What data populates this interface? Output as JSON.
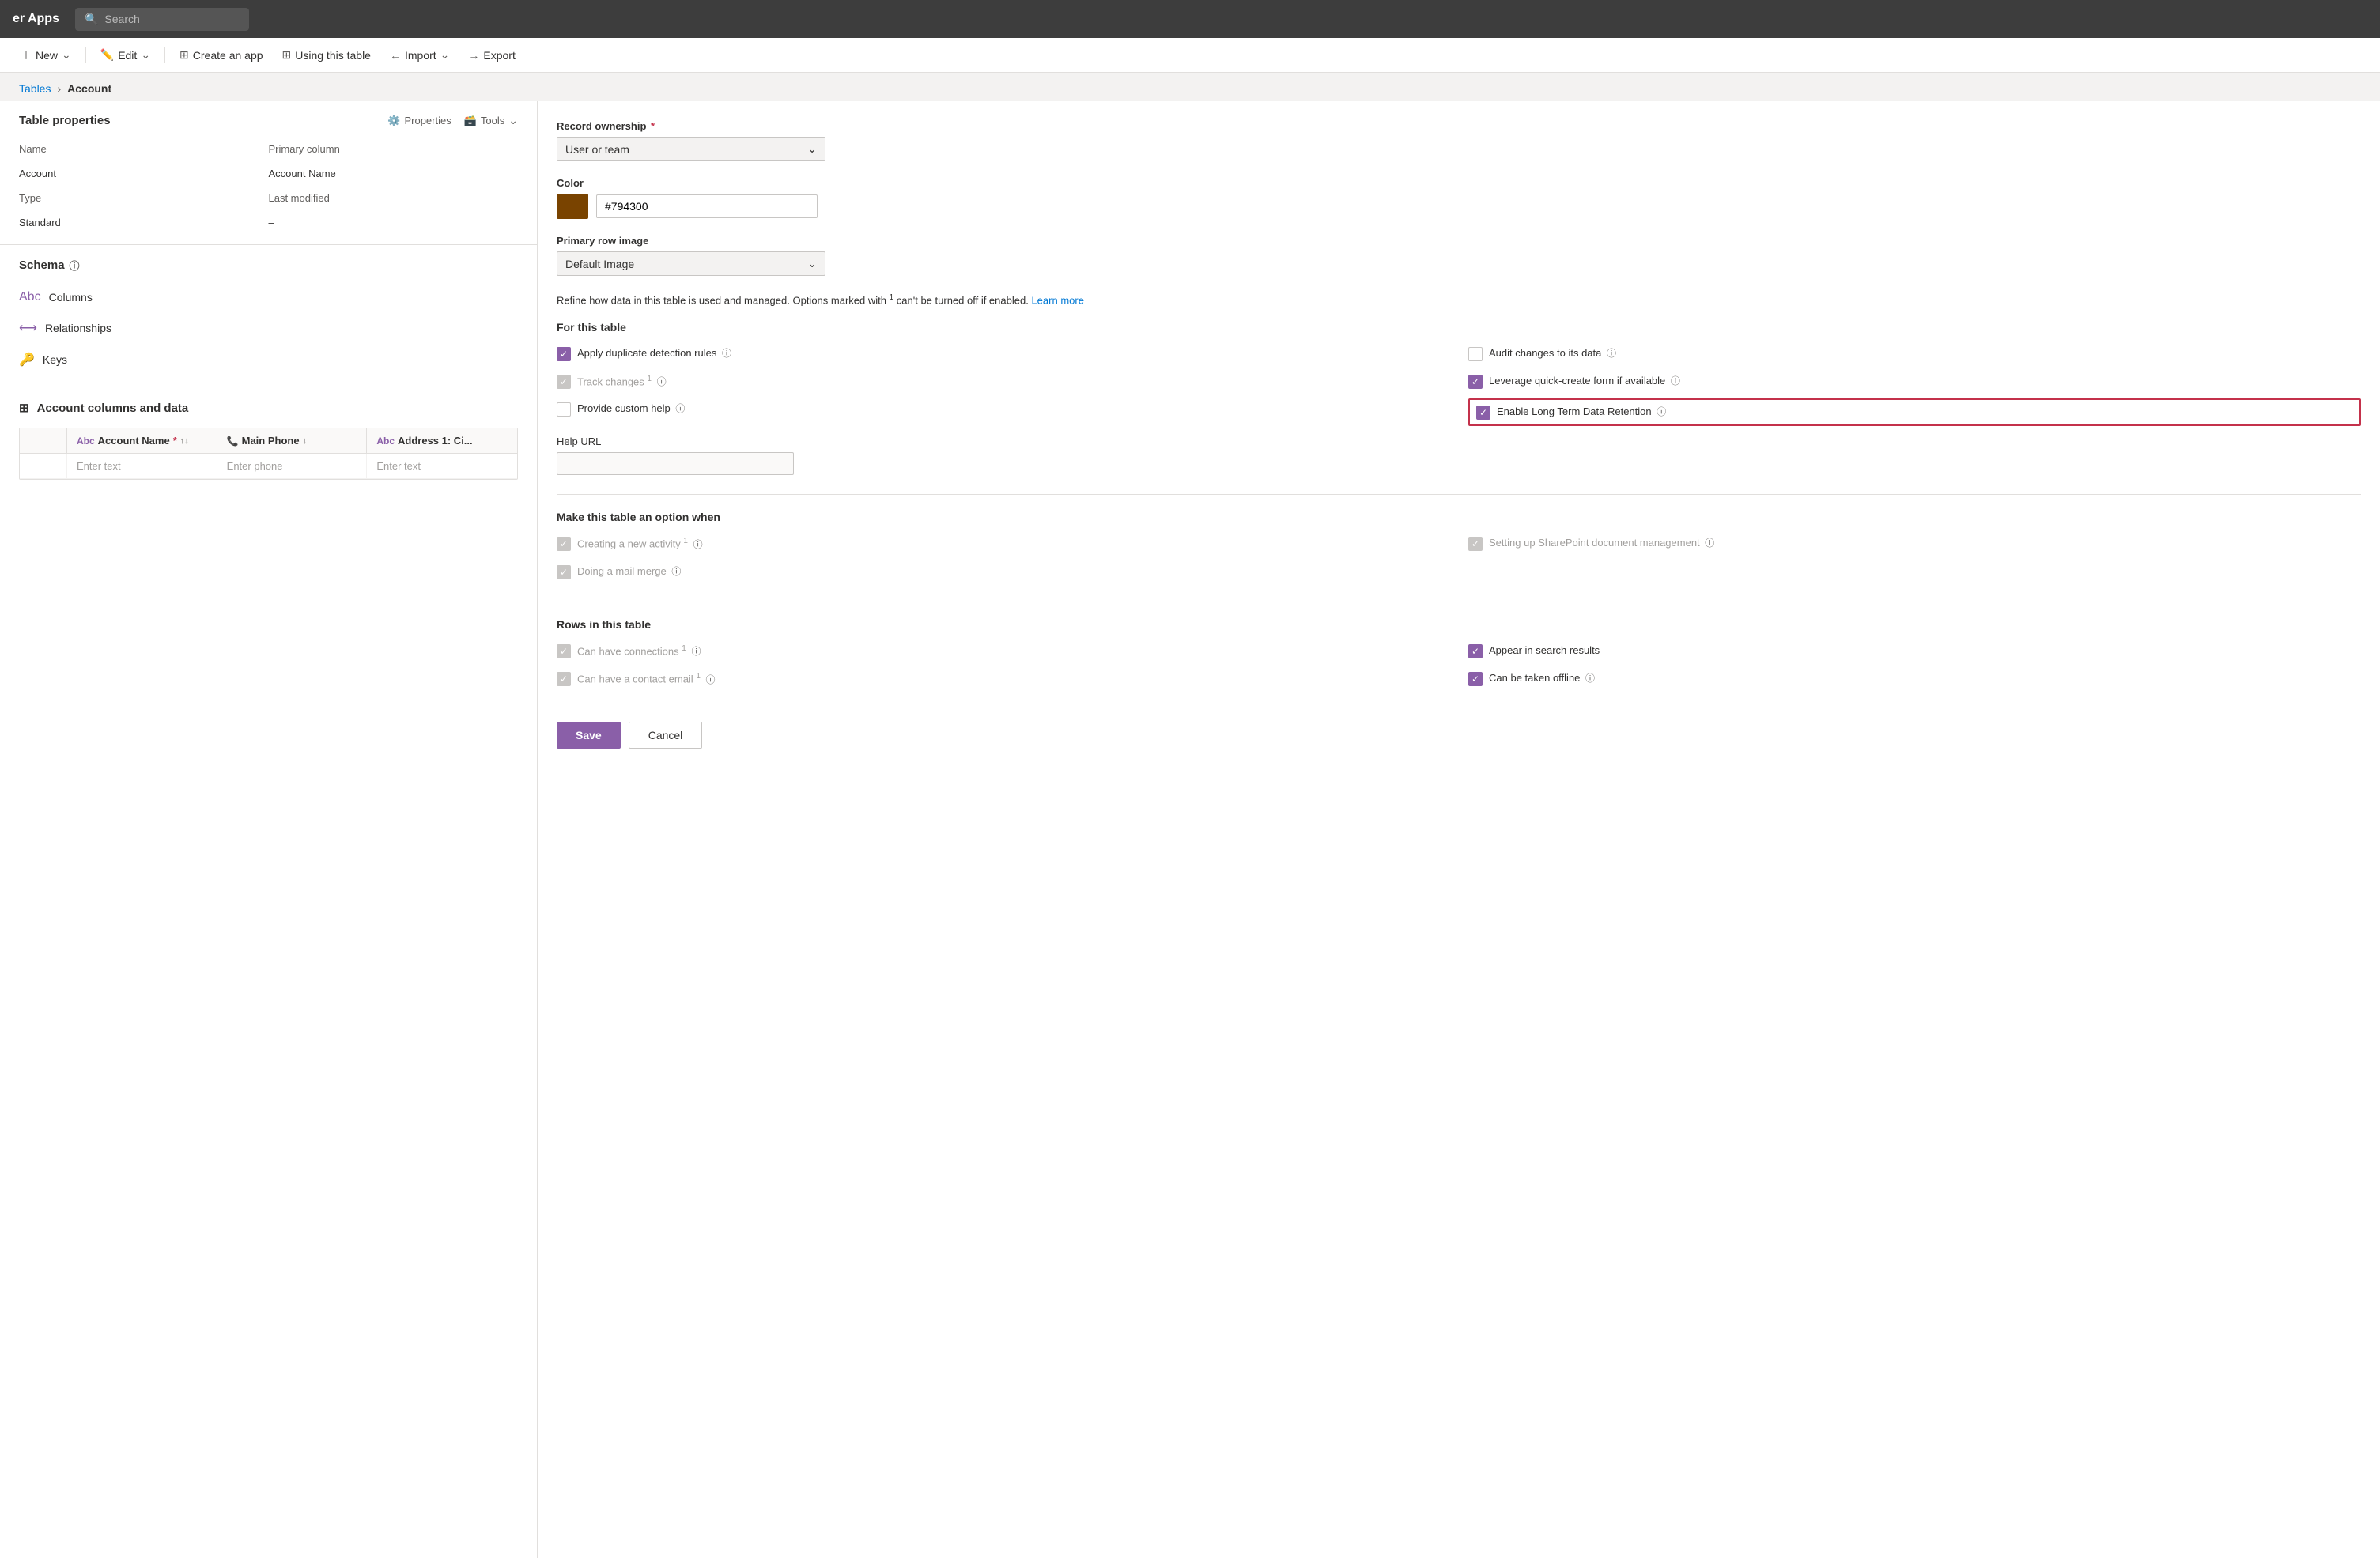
{
  "topbar": {
    "title": "er Apps",
    "search_placeholder": "Search"
  },
  "commandbar": {
    "new_label": "New",
    "edit_label": "Edit",
    "create_app_label": "Create an app",
    "using_table_label": "Using this table",
    "import_label": "Import",
    "export_label": "Export"
  },
  "breadcrumb": {
    "parent": "Tables",
    "separator": "›",
    "current": "Account"
  },
  "table_properties": {
    "section_title": "Table properties",
    "properties_label": "Properties",
    "tools_label": "Tools",
    "name_label": "Name",
    "name_value": "Account",
    "primary_column_label": "Primary column",
    "primary_column_value": "Account Name",
    "type_label": "Type",
    "type_value": "Standard",
    "last_modified_label": "Last modified",
    "last_modified_value": "–"
  },
  "schema": {
    "title": "Schema",
    "info_icon": "ⓘ",
    "columns_label": "Columns",
    "relationships_label": "Relationships",
    "keys_label": "Keys"
  },
  "columns_data": {
    "section_title": "Account columns and data",
    "columns": [
      {
        "name": "Account Name",
        "type": "Abc",
        "required": true
      },
      {
        "name": "Main Phone",
        "type": "phone",
        "required": false
      },
      {
        "name": "Address 1: Ci...",
        "type": "Abc",
        "required": false
      }
    ],
    "enter_text": "Enter text",
    "enter_phone": "Enter phone"
  },
  "properties_panel": {
    "record_ownership_label": "Record ownership",
    "record_ownership_required": "*",
    "record_ownership_value": "User or team",
    "color_label": "Color",
    "color_hex": "#794300",
    "primary_row_image_label": "Primary row image",
    "primary_row_image_value": "Default Image",
    "refine_text": "Refine how data in this table is used and managed. Options marked with",
    "refine_sup": "1",
    "refine_text2": "can't be turned off if enabled.",
    "learn_more": "Learn more",
    "for_this_table_title": "For this table",
    "options": [
      {
        "id": "duplicate",
        "label": "Apply duplicate detection rules",
        "checked": true,
        "disabled": false,
        "info": true
      },
      {
        "id": "audit",
        "label": "Audit changes to its data",
        "checked": false,
        "disabled": false,
        "info": true
      },
      {
        "id": "track",
        "label": "Track changes",
        "checked": true,
        "disabled": true,
        "sup": "1",
        "info": true
      },
      {
        "id": "quick_create",
        "label": "Leverage quick-create form if available",
        "checked": true,
        "disabled": false,
        "info": true
      },
      {
        "id": "custom_help",
        "label": "Provide custom help",
        "checked": false,
        "disabled": false,
        "info": true
      },
      {
        "id": "long_term",
        "label": "Enable Long Term Data Retention",
        "checked": true,
        "disabled": false,
        "info": true,
        "highlighted": true
      }
    ],
    "help_url_label": "Help URL",
    "make_option_title": "Make this table an option when",
    "make_options": [
      {
        "id": "new_activity",
        "label": "Creating a new activity",
        "checked": true,
        "disabled": true,
        "sup": "1",
        "info": true
      },
      {
        "id": "sharepoint",
        "label": "Setting up SharePoint document management",
        "checked": true,
        "disabled": true,
        "info": true
      },
      {
        "id": "mail_merge",
        "label": "Doing a mail merge",
        "checked": true,
        "disabled": true,
        "info": true
      }
    ],
    "rows_title": "Rows in this table",
    "row_options": [
      {
        "id": "connections",
        "label": "Can have connections",
        "checked": true,
        "disabled": true,
        "sup": "1",
        "info": true
      },
      {
        "id": "search",
        "label": "Appear in search results",
        "checked": true,
        "disabled": false,
        "info": false
      },
      {
        "id": "contact_email",
        "label": "Can have a contact email",
        "checked": true,
        "disabled": true,
        "sup": "1",
        "info": true
      },
      {
        "id": "offline",
        "label": "Can be taken offline",
        "checked": true,
        "disabled": false,
        "info": true
      }
    ],
    "save_label": "Save",
    "cancel_label": "Cancel"
  }
}
